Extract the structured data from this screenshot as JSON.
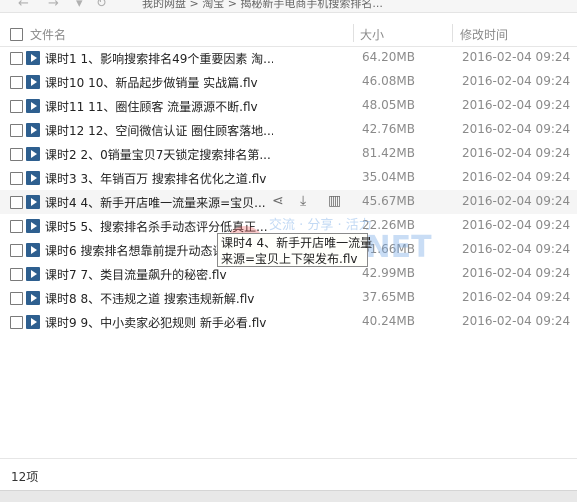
{
  "breadcrumb": {
    "text": "我的网盘  >  淘宝  >  揭秘新手电商手机搜索排名..."
  },
  "columns": {
    "name": "文件名",
    "size": "大小",
    "modified": "修改时间"
  },
  "files": [
    {
      "name": "课时1 1、影响搜索排名49个重要因素 淘...",
      "size": "64.20MB",
      "date": "2016-02-04 09:24"
    },
    {
      "name": "课时10 10、新品起步做销量 实战篇.flv",
      "size": "46.08MB",
      "date": "2016-02-04 09:24"
    },
    {
      "name": "课时11 11、圈住顾客 流量源源不断.flv",
      "size": "48.05MB",
      "date": "2016-02-04 09:24"
    },
    {
      "name": "课时12 12、空间微信认证 圈住顾客落地...",
      "size": "42.76MB",
      "date": "2016-02-04 09:24"
    },
    {
      "name": "课时2 2、0销量宝贝7天锁定搜索排名第...",
      "size": "81.42MB",
      "date": "2016-02-04 09:24"
    },
    {
      "name": "课时3 3、年销百万 搜索排名优化之道.flv",
      "size": "35.04MB",
      "date": "2016-02-04 09:24"
    },
    {
      "name": "课时4 4、新手开店唯一流量来源=宝贝...",
      "size": "45.67MB",
      "date": "2016-02-04 09:24"
    },
    {
      "name": "课时5 5、搜索排名杀手动态评分低真正...",
      "size": "22.26MB",
      "date": "2016-02-04 09:24"
    },
    {
      "name": "课时6 搜索排名想靠前提升动态评分...",
      "size": "61.66MB",
      "date": "2016-02-04 09:24"
    },
    {
      "name": "课时7 7、类目流量飙升的秘密.flv",
      "size": "42.99MB",
      "date": "2016-02-04 09:24"
    },
    {
      "name": "课时8 8、不违规之道 搜索违规新解.flv",
      "size": "37.65MB",
      "date": "2016-02-04 09:24"
    },
    {
      "name": "课时9 9、中小卖家必犯规则 新手必看.flv",
      "size": "40.24MB",
      "date": "2016-02-04 09:24"
    }
  ],
  "tooltip": {
    "line1": "课时4 4、新手开店唯一流量",
    "line2": "来源=宝贝上下架发布.flv"
  },
  "watermark": {
    "small": "交流 · 分享 · 活力",
    "big": "TB56.NET"
  },
  "footer": {
    "count": "12项"
  },
  "colors": {
    "file_icon": "#2e5f8f",
    "hover_row": "#f5f5f5",
    "muted_text": "#8a8a8a"
  },
  "icons": [
    "share-icon",
    "download-icon",
    "delete-icon",
    "video-file-icon"
  ]
}
